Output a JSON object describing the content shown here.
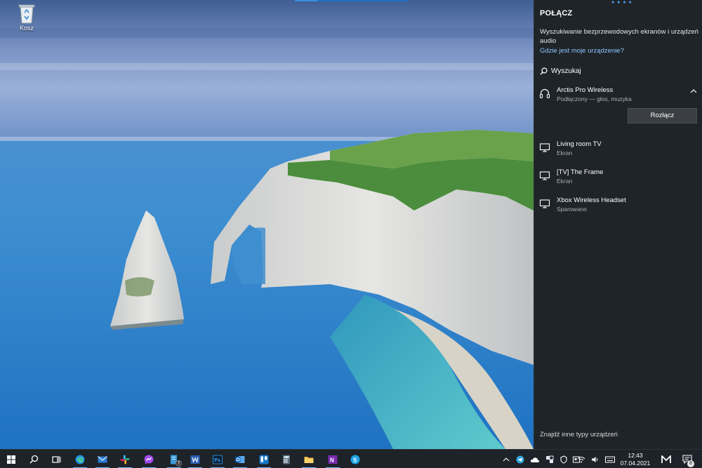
{
  "desktop": {
    "icons": [
      {
        "label": "Kosz",
        "icon": "recycle-bin-icon"
      }
    ]
  },
  "connect_panel": {
    "title": "POŁĄCZ",
    "searching_text": "Wyszukiwanie bezprzewodowych ekranów i urządzeń audio",
    "find_device_link": "Gdzie jest moje urządzenie?",
    "search_label": "Wyszukaj",
    "devices": [
      {
        "name": "Arctis Pro Wireless",
        "status": "Podłączony — głos, muzyka",
        "icon": "headset-icon",
        "expanded": true,
        "action_label": "Rozłącz"
      },
      {
        "name": "Living room TV",
        "status": "Ekran",
        "icon": "monitor-icon"
      },
      {
        "name": "[TV] The Frame",
        "status": "Ekran",
        "icon": "monitor-icon"
      },
      {
        "name": "Xbox Wireless Headset",
        "status": "Sparowano",
        "icon": "monitor-icon"
      }
    ],
    "footer_link": "Znajdź inne typy urządzeń"
  },
  "taskbar": {
    "apps": [
      {
        "name": "start",
        "icon": "windows-start-icon"
      },
      {
        "name": "search",
        "icon": "search-icon"
      },
      {
        "name": "task-view",
        "icon": "task-view-icon"
      },
      {
        "name": "edge",
        "icon": "edge-icon"
      },
      {
        "name": "mail",
        "icon": "mail-icon"
      },
      {
        "name": "slack",
        "icon": "slack-icon"
      },
      {
        "name": "messenger",
        "icon": "messenger-icon"
      },
      {
        "name": "sticky-notes",
        "icon": "notes-icon",
        "badge": "7"
      },
      {
        "name": "word",
        "icon": "word-icon"
      },
      {
        "name": "photoshop",
        "icon": "photoshop-icon"
      },
      {
        "name": "outlook",
        "icon": "outlook-icon"
      },
      {
        "name": "trello",
        "icon": "trello-icon"
      },
      {
        "name": "calculator",
        "icon": "calculator-icon"
      },
      {
        "name": "file-explorer",
        "icon": "folder-icon"
      },
      {
        "name": "onenote",
        "icon": "onenote-icon"
      },
      {
        "name": "skype",
        "icon": "skype-icon"
      }
    ],
    "tray": {
      "time": "12:43",
      "date": "07.04.2021",
      "notification_count": "8"
    }
  }
}
